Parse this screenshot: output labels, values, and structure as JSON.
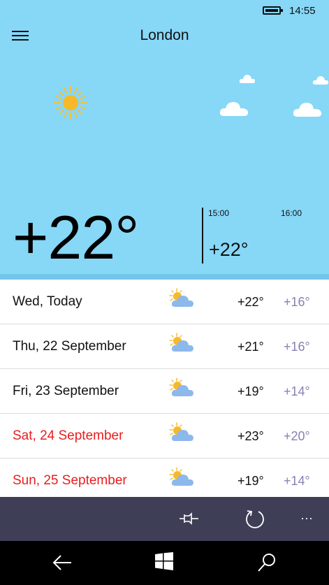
{
  "status": {
    "time": "14:55"
  },
  "header": {
    "city": "London"
  },
  "current": {
    "temperature": "+22°",
    "hourly": [
      {
        "time": "15:00",
        "temperature": "+22°"
      },
      {
        "time": "16:00",
        "temperature": ""
      }
    ]
  },
  "forecast": [
    {
      "day": "Wed, Today",
      "high": "+22°",
      "low": "+16°",
      "icon": "partly-cloudy-icon",
      "weekend": false
    },
    {
      "day": "Thu, 22 September",
      "high": "+21°",
      "low": "+16°",
      "icon": "partly-cloudy-icon",
      "weekend": false
    },
    {
      "day": "Fri, 23 September",
      "high": "+19°",
      "low": "+14°",
      "icon": "partly-cloudy-icon",
      "weekend": false
    },
    {
      "day": "Sat, 24 September",
      "high": "+23°",
      "low": "+20°",
      "icon": "partly-cloudy-icon",
      "weekend": true
    },
    {
      "day": "Sun, 25 September",
      "high": "+19°",
      "low": "+14°",
      "icon": "partly-cloudy-icon",
      "weekend": true
    }
  ],
  "app_bar": {
    "pin_icon": "pin-icon",
    "refresh_icon": "refresh-icon",
    "more_label": "···"
  },
  "colors": {
    "sky": "#87d7f7",
    "weekend": "#e81d1d",
    "low_temp": "#8a7fb4",
    "app_bar": "#3e3f57"
  }
}
